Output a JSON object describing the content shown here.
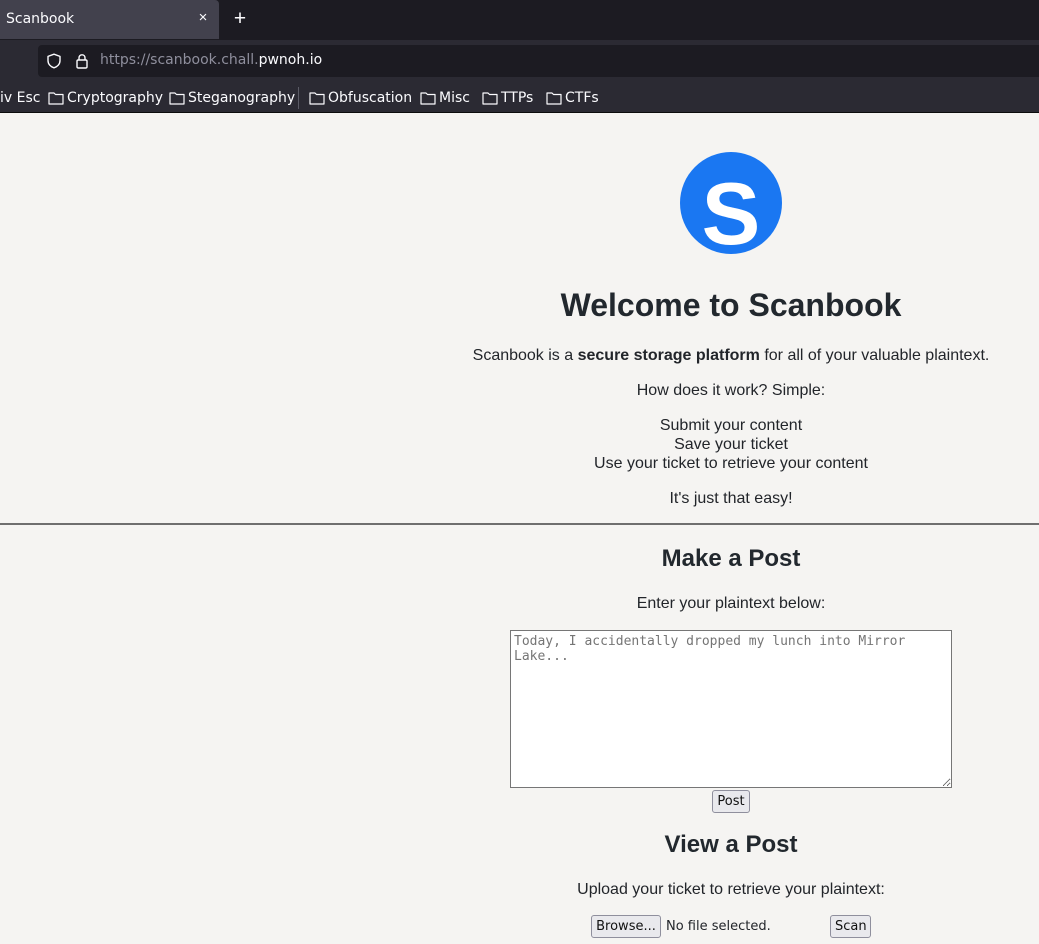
{
  "browser": {
    "tab_title": "Scanbook",
    "tab_close": "×",
    "new_tab": "+",
    "url_prefix": "https://scanbook.chall.",
    "url_domain": "pwnoh.io",
    "bookmarks": [
      "iv Esc",
      "Cryptography",
      "Steganography",
      "Obfuscation",
      "Misc",
      "TTPs",
      "CTFs"
    ]
  },
  "intro": {
    "logo_letter": "S",
    "title": "Welcome to Scanbook",
    "desc_prefix": "Scanbook is a ",
    "desc_bold": "secure storage platform",
    "desc_suffix": " for all of your valuable plaintext.",
    "how": "How does it work? Simple:",
    "steps": [
      "Submit your content",
      "Save your ticket",
      "Use your ticket to retrieve your content"
    ],
    "easy": "It's just that easy!"
  },
  "make_post": {
    "title": "Make a Post",
    "label": "Enter your plaintext below:",
    "placeholder": "Today, I accidentally dropped my lunch into Mirror Lake...",
    "post_button": "Post"
  },
  "view_post": {
    "title": "View a Post",
    "label": "Upload your ticket to retrieve your plaintext:",
    "browse_button": "Browse...",
    "file_status": "No file selected.",
    "scan_button": "Scan"
  },
  "colors": {
    "logo_blue": "#1a77f2",
    "page_background": "#f5f4f2",
    "chrome_dark": "#1c1b22"
  }
}
